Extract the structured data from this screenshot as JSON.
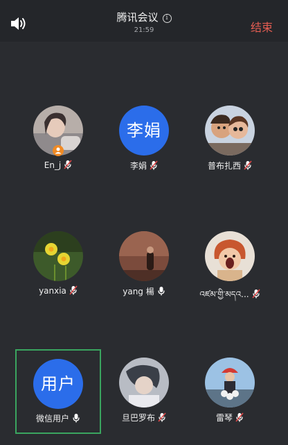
{
  "header": {
    "title": "腾讯会议",
    "time": "21:59",
    "end_label": "结束",
    "info_glyph": "i",
    "speaker_icon": "speaker-icon"
  },
  "participants": [
    {
      "name": "En_j",
      "avatar_type": "photo",
      "avatar_text": "",
      "muted": true,
      "host": true
    },
    {
      "name": "李娟",
      "avatar_type": "text",
      "avatar_text": "李娟",
      "muted": true,
      "host": false
    },
    {
      "name": "普布扎西",
      "avatar_type": "photo",
      "avatar_text": "",
      "muted": true,
      "host": false
    },
    {
      "name": "yanxia",
      "avatar_type": "photo",
      "avatar_text": "",
      "muted": true,
      "host": false
    },
    {
      "name": "yang 楊",
      "avatar_type": "photo",
      "avatar_text": "",
      "muted": false,
      "host": false
    },
    {
      "name": "འཛམ་གྱི་མདའ...",
      "avatar_type": "photo",
      "avatar_text": "",
      "muted": true,
      "host": false
    },
    {
      "name": "微信用户",
      "avatar_type": "text",
      "avatar_text": "用户",
      "muted": false,
      "host": false,
      "selected": true
    },
    {
      "name": "旦巴罗布",
      "avatar_type": "photo",
      "avatar_text": "",
      "muted": true,
      "host": false
    },
    {
      "name": "雷琴",
      "avatar_type": "photo",
      "avatar_text": "",
      "muted": true,
      "host": false
    }
  ],
  "colors": {
    "background": "#2a2c30",
    "topbar": "#24262a",
    "end_button": "#e45d52",
    "avatar_blue": "#2b6dea",
    "selected_border": "#3aa55f",
    "muted_red": "#e04848",
    "host_badge": "#f08a24"
  }
}
